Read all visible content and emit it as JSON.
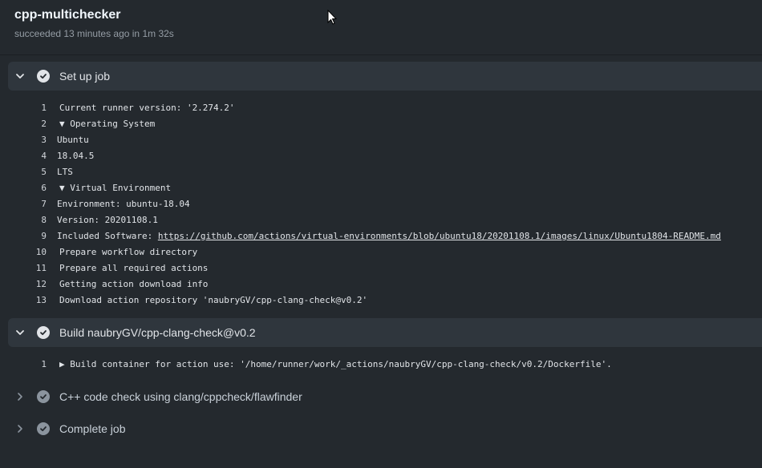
{
  "job": {
    "title": "cpp-multichecker",
    "status": "succeeded 13 minutes ago in 1m 32s"
  },
  "steps": [
    {
      "title": "Set up job",
      "expanded": true,
      "status": "success",
      "log": [
        {
          "n": "1",
          "prefix": "",
          "text": "Current runner version: '2.274.2'"
        },
        {
          "n": "2",
          "prefix": "▼ ",
          "text": "Operating System"
        },
        {
          "n": "3",
          "prefix": "",
          "text": "Ubuntu",
          "indent": true
        },
        {
          "n": "4",
          "prefix": "",
          "text": "18.04.5",
          "indent": true
        },
        {
          "n": "5",
          "prefix": "",
          "text": "LTS",
          "indent": true
        },
        {
          "n": "6",
          "prefix": "▼ ",
          "text": "Virtual Environment"
        },
        {
          "n": "7",
          "prefix": "",
          "text": "Environment: ubuntu-18.04",
          "indent": true
        },
        {
          "n": "8",
          "prefix": "",
          "text": "Version: 20201108.1",
          "indent": true
        },
        {
          "n": "9",
          "prefix": "",
          "text": "Included Software: ",
          "indent": true,
          "link": "https://github.com/actions/virtual-environments/blob/ubuntu18/20201108.1/images/linux/Ubuntu1804-README.md"
        },
        {
          "n": "10",
          "prefix": "",
          "text": "Prepare workflow directory"
        },
        {
          "n": "11",
          "prefix": "",
          "text": "Prepare all required actions"
        },
        {
          "n": "12",
          "prefix": "",
          "text": "Getting action download info"
        },
        {
          "n": "13",
          "prefix": "",
          "text": "Download action repository 'naubryGV/cpp-clang-check@v0.2'"
        }
      ]
    },
    {
      "title": "Build naubryGV/cpp-clang-check@v0.2",
      "expanded": true,
      "status": "success",
      "log": [
        {
          "n": "1",
          "prefix": "▶ ",
          "text": "Build container for action use: '/home/runner/work/_actions/naubryGV/cpp-clang-check/v0.2/Dockerfile'."
        }
      ]
    },
    {
      "title": "C++ code check using clang/cppcheck/flawfinder",
      "expanded": false,
      "status": "success"
    },
    {
      "title": "Complete job",
      "expanded": false,
      "status": "success"
    }
  ],
  "icons": {
    "chevron_down": "chevron-down-icon",
    "chevron_right": "chevron-right-icon",
    "check": "check-circle-icon",
    "cursor": "mouse-pointer-icon"
  }
}
